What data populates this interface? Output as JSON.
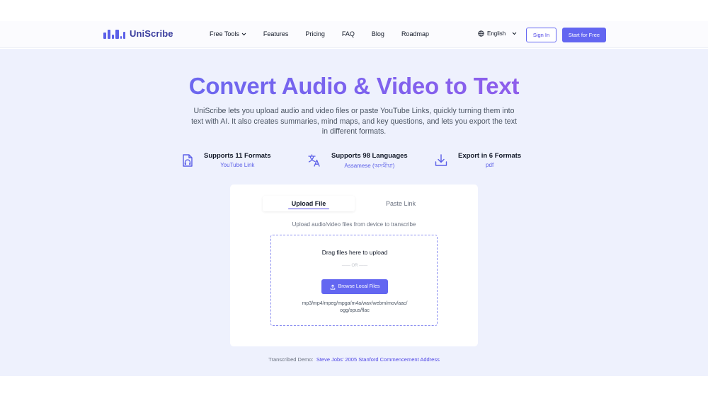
{
  "brand": {
    "name": "UniScribe",
    "color": "#5b5fe8"
  },
  "nav": {
    "items": [
      {
        "label": "Free Tools",
        "dropdown": true
      },
      {
        "label": "Features"
      },
      {
        "label": "Pricing"
      },
      {
        "label": "FAQ"
      },
      {
        "label": "Blog"
      },
      {
        "label": "Roadmap"
      }
    ],
    "language": "English",
    "sign_in": "Sign In",
    "start": "Start for Free"
  },
  "hero": {
    "title": "Convert Audio & Video to Text",
    "subtitle": "UniScribe lets you upload audio and video files or paste YouTube Links, quickly turning them into text with AI. It also creates summaries, mind maps, and key questions, and lets you export the text in different formats."
  },
  "features": [
    {
      "icon": "audio-file-icon",
      "title": "Supports 11 Formats",
      "value": "YouTube Link"
    },
    {
      "icon": "translate-icon",
      "title": "Supports 98 Languages",
      "value": "Assamese (অসমীয়া)"
    },
    {
      "icon": "download-icon",
      "title": "Export in 6 Formats",
      "value": "pdf"
    }
  ],
  "upload": {
    "tabs": [
      {
        "label": "Upload File",
        "active": true
      },
      {
        "label": "Paste Link",
        "active": false
      }
    ],
    "hint": "Upload audio/video files from device to transcribe",
    "drag_text": "Drag files here to upload",
    "or_text": "—— OR ——",
    "browse_label": "Browse Local Files",
    "formats_line1": "mp3/mp4/mpeg/mpga/m4a/wav/webm/mov/aac/",
    "formats_line2": "ogg/opus/flac"
  },
  "demo": {
    "label": "Transcribed Demo:",
    "link": "Steve Jobs' 2005 Stanford Commencement Address"
  }
}
